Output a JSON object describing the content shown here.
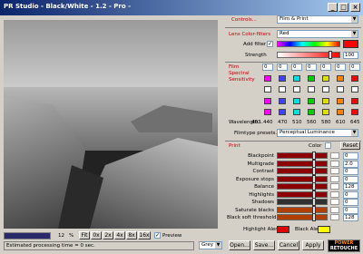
{
  "window": {
    "title": "PR Studio - Black/White - 1.2 - Pro -",
    "minimize": "_",
    "maximize": "□",
    "close": "×"
  },
  "controls": {
    "label": "Controls...",
    "value": "Film & Print"
  },
  "lens": {
    "label": "Lens Color-filters",
    "value": "Red",
    "add_filter": "Add filter",
    "add_filter_checked": true,
    "strength_label": "Strength",
    "strength_value": "100"
  },
  "film": {
    "label_line1": "Film",
    "label_line2": "Spectral",
    "label_line3": "Sensitivity",
    "values": [
      "0",
      "0",
      "0",
      "0",
      "0",
      "0",
      "0"
    ],
    "channels": [
      {
        "swatch": "#ff00ff",
        "wavelength": "440"
      },
      {
        "swatch": "#4040ff",
        "wavelength": "470"
      },
      {
        "swatch": "#00e0e0",
        "wavelength": "510"
      },
      {
        "swatch": "#00d000",
        "wavelength": "560"
      },
      {
        "swatch": "#e0e000",
        "wavelength": "580"
      },
      {
        "swatch": "#ff8000",
        "wavelength": "610"
      },
      {
        "swatch": "#ff0000",
        "wavelength": "645"
      }
    ],
    "wavelength_label": "Wavelength...",
    "wavelength_first": "403",
    "filmtype_label": "Filmtype presets...",
    "filmtype_value": "Perceptual Luminance"
  },
  "print": {
    "label": "Print",
    "color_label": "Color",
    "reset": "Reset",
    "rows": [
      {
        "label": "Blackpoint",
        "value": "0",
        "color": "#8b0000"
      },
      {
        "label": "Multigrade",
        "value": "2.0",
        "color": "#8b0000"
      },
      {
        "label": "Contrast",
        "value": "0",
        "color": "#8b0000"
      },
      {
        "label": "Exposure stops",
        "value": "0",
        "color": "#8b0000"
      },
      {
        "label": "Balance",
        "value": "128",
        "color": "#8b0000"
      },
      {
        "label": "Highlights",
        "value": "0",
        "color": "#8b0000"
      },
      {
        "label": "Shadows",
        "value": "0",
        "color": "#303030"
      },
      {
        "label": "Saturate blacks",
        "value": "0",
        "color": "#b04000"
      },
      {
        "label": "Black soft threshold",
        "value": "128",
        "color": "#b04000"
      }
    ],
    "highlight_alert": "Highlight Alert",
    "black_alert": "Black Alert"
  },
  "zoom": {
    "value": "12",
    "unit": "%",
    "buttons": [
      "Fit",
      "0x",
      "2x",
      "4x",
      "8x",
      "16x"
    ],
    "preview": "Preview",
    "preview_checked": true
  },
  "status": "Estimated processing time = 0 sec.",
  "bottom": {
    "mode": "Grey",
    "open": "Open...",
    "save": "Save...",
    "cancel": "Cancel",
    "apply": "Apply",
    "logo_line1": "POWER",
    "logo_line2": "RETOUCHE"
  }
}
